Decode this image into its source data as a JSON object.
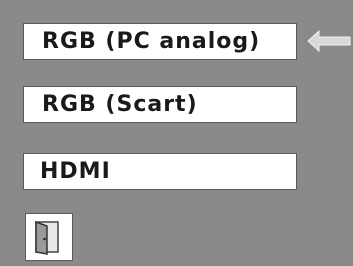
{
  "menu": {
    "items": [
      {
        "label": "RGB (PC analog)",
        "selected": true
      },
      {
        "label": "RGB (Scart)",
        "selected": false
      },
      {
        "label": "HDMI",
        "selected": false
      }
    ]
  },
  "icons": {
    "selection_pointer": "left-arrow-icon",
    "exit": "door-exit-icon"
  },
  "colors": {
    "background": "#8a8a8a",
    "item_background": "#ffffff",
    "item_text": "#1a1a1a",
    "pointer": "#d9d9d9"
  }
}
